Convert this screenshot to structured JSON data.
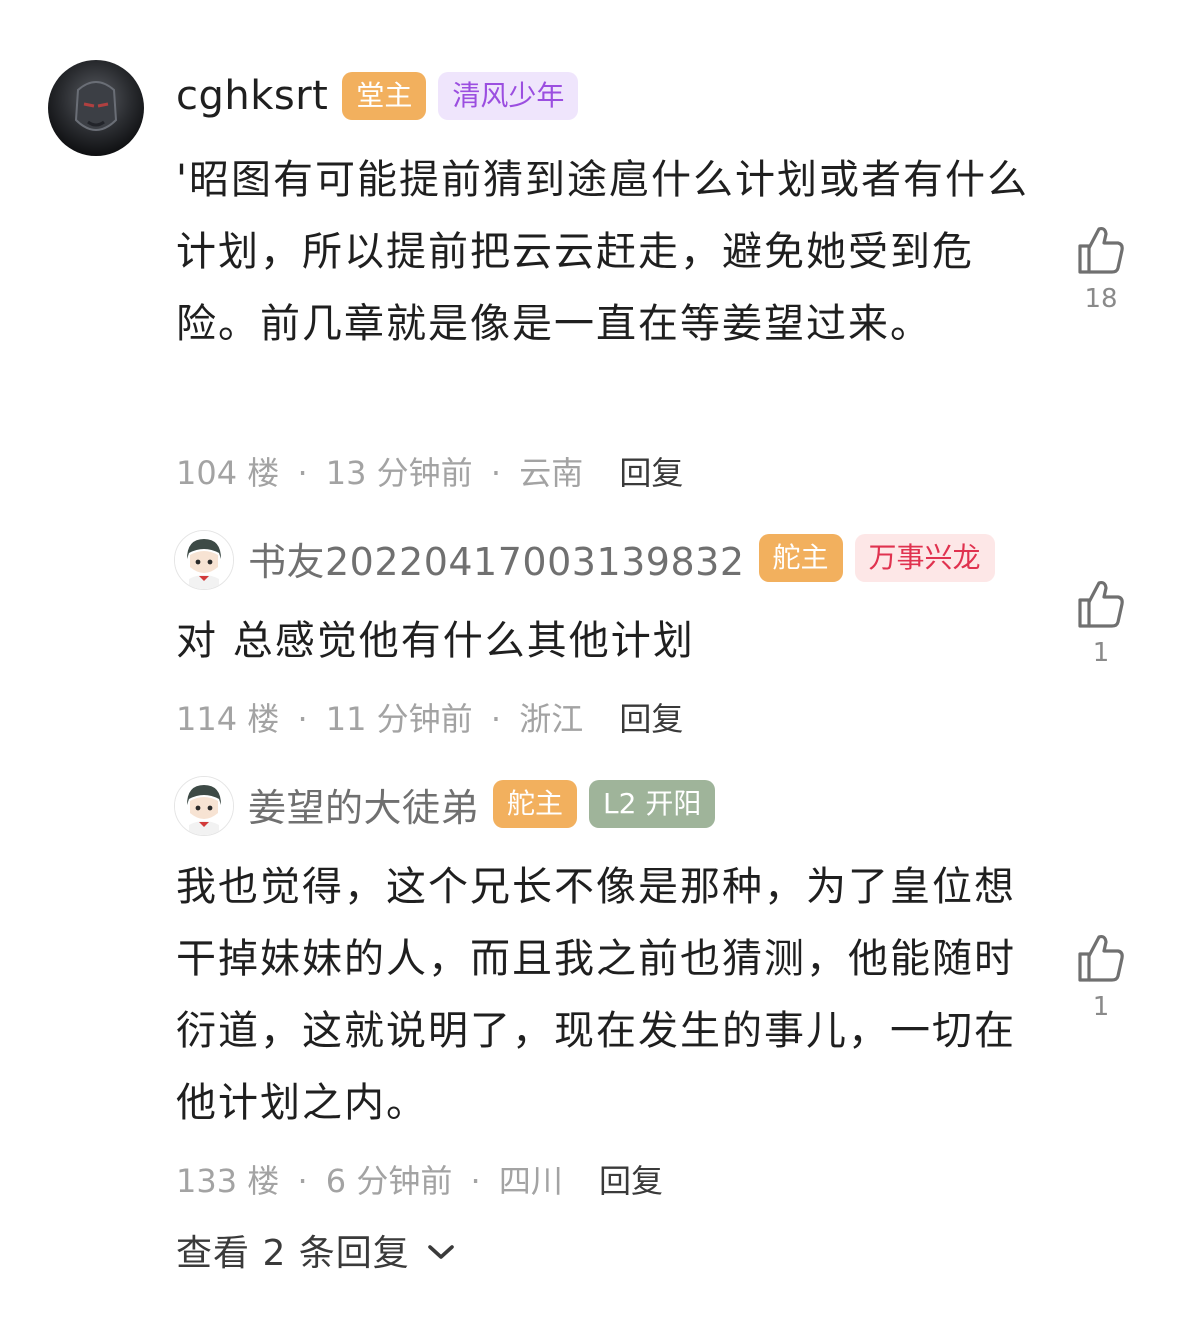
{
  "comments": [
    {
      "username": "cghksrt",
      "badges": [
        {
          "label": "堂主",
          "style": "orange"
        },
        {
          "label": "清风少年",
          "style": "purple"
        }
      ],
      "text": "'昭图有可能提前猜到途扈什么计划或者有什么计划，所以提前把云云赶走，避免她受到危险。前几章就是像是一直在等姜望过来。",
      "floor": "104 楼",
      "time": "13 分钟前",
      "location": "云南",
      "reply_label": "回复",
      "likes": "18"
    },
    {
      "username": "书友20220417003139832",
      "badges": [
        {
          "label": "舵主",
          "style": "orange"
        },
        {
          "label": "万事兴龙",
          "style": "pink"
        }
      ],
      "text": "对 总感觉他有什么其他计划",
      "floor": "114 楼",
      "time": "11 分钟前",
      "location": "浙江",
      "reply_label": "回复",
      "likes": "1"
    },
    {
      "username": "姜望的大徒弟",
      "badges": [
        {
          "label": "舵主",
          "style": "orange"
        },
        {
          "label": "L2 开阳",
          "style": "green"
        }
      ],
      "text": "我也觉得，这个兄长不像是那种，为了皇位想干掉妹妹的人，而且我之前也猜测，他能随时衍道，这就说明了，现在发生的事儿，一切在他计划之内。",
      "floor": "133 楼",
      "time": "6 分钟前",
      "location": "四川",
      "reply_label": "回复",
      "likes": "1"
    }
  ],
  "meta_separator": "·",
  "view_replies_label": "查看 2 条回复",
  "icons": {
    "like": "thumbs-up-icon",
    "chevron": "chevron-down-icon"
  },
  "colors": {
    "badge_orange": "#f2b05e",
    "badge_purple_bg": "#efe5fc",
    "badge_purple_text": "#9b4ee0",
    "badge_pink_bg": "#fde7e7",
    "badge_pink_text": "#e0324f",
    "badge_green": "#9fb49a",
    "meta_gray": "#a3a3a3"
  }
}
